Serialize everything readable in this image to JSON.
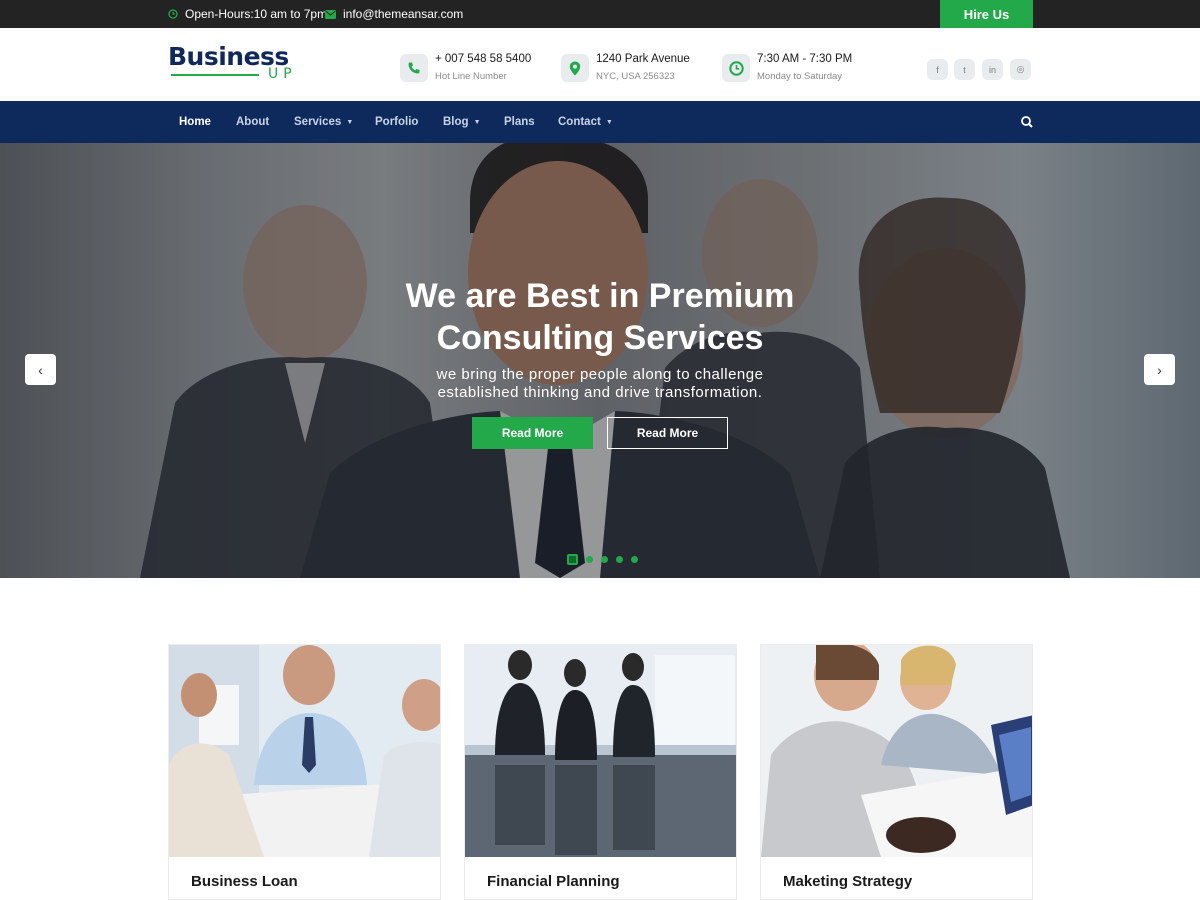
{
  "topbar": {
    "hours": "Open-Hours:10 am to 7pm",
    "email": "info@themeansar.com",
    "hire_label": "Hire Us"
  },
  "logo": {
    "name": "Business",
    "sub": "UP"
  },
  "header": {
    "contacts": [
      {
        "main": "+ 007 548 58 5400",
        "sub": "Hot Line Number",
        "icon": "phone-icon"
      },
      {
        "main": "1240 Park Avenue",
        "sub": "NYC, USA 256323",
        "icon": "location-pin-icon"
      },
      {
        "main": "7:30 AM - 7:30 PM",
        "sub": "Monday to Saturday",
        "icon": "clock-icon"
      }
    ],
    "social": [
      {
        "glyph": "f",
        "icon": "facebook-icon"
      },
      {
        "glyph": "t",
        "icon": "twitter-icon"
      },
      {
        "glyph": "in",
        "icon": "linkedin-icon"
      },
      {
        "glyph": "◎",
        "icon": "instagram-icon"
      }
    ]
  },
  "nav": {
    "items": [
      {
        "label": "Home",
        "active": true
      },
      {
        "label": "About"
      },
      {
        "label": "Services",
        "dropdown": true
      },
      {
        "label": "Porfolio"
      },
      {
        "label": "Blog",
        "dropdown": true
      },
      {
        "label": "Plans"
      },
      {
        "label": "Contact",
        "dropdown": true
      }
    ],
    "search_icon": "search-icon"
  },
  "hero": {
    "title_line1": "We are Best in Premium",
    "title_line2": "Consulting Services",
    "subtitle_line1": "we bring the proper people along to challenge",
    "subtitle_line2": "established thinking and drive transformation.",
    "primary_button": "Read More",
    "secondary_button": "Read More",
    "prev_arrow": "‹",
    "next_arrow": "›",
    "slide_count": 5,
    "active_slide": 1
  },
  "cards": [
    {
      "title": "Business Loan"
    },
    {
      "title": "Financial Planning"
    },
    {
      "title": "Maketing Strategy"
    }
  ],
  "colors": {
    "brand_navy": "#0e2a5d",
    "accent_green": "#23a84a",
    "topbar_dark": "#232323"
  }
}
